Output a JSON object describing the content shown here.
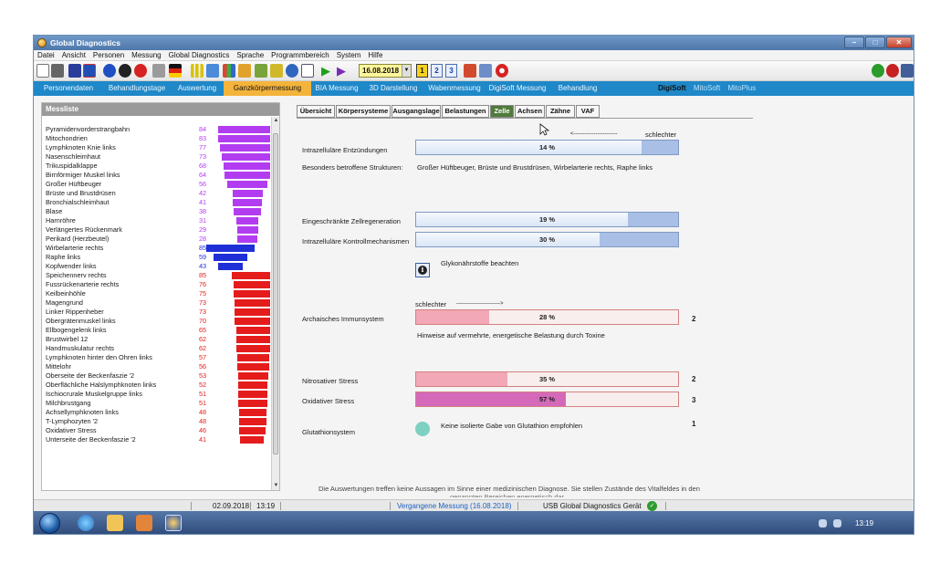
{
  "window": {
    "title": "Global Diagnostics",
    "min": "–",
    "max": "□",
    "close": "✕"
  },
  "menu": [
    "Datei",
    "Ansicht",
    "Personen",
    "Messung",
    "Global Diagnostics",
    "Sprache",
    "Programmbereich",
    "System",
    "Hilfe"
  ],
  "toolbar": {
    "date": "16.08.2018",
    "pages": [
      "1",
      "2",
      "3"
    ]
  },
  "nav": {
    "tabs": [
      "Personendaten",
      "Behandlungstage",
      "Auswertung",
      "Ganzkörpermessung",
      "BIA Messung",
      "3D Darstellung",
      "Wabenmessung",
      "DigiSoft Messung",
      "Behandlung"
    ],
    "right": [
      "DigiSoft",
      "MitoSoft",
      "MitoPlus"
    ]
  },
  "messliste": {
    "title": "Messliste",
    "rows": [
      {
        "name": "Pyramidenvorderstrangbahn",
        "value": 84,
        "color": "#b23df0"
      },
      {
        "name": "Mitochondrien",
        "value": 83,
        "color": "#b23df0"
      },
      {
        "name": "Lymphknoten Knie links",
        "value": 77,
        "color": "#b23df0"
      },
      {
        "name": "Nasenschleimhaut",
        "value": 73,
        "color": "#b23df0"
      },
      {
        "name": "Trikuspidalklappe",
        "value": 68,
        "color": "#b23df0"
      },
      {
        "name": "Birnförmiger Muskel links",
        "value": 64,
        "color": "#b23df0"
      },
      {
        "name": "Großer Hüftbeuger",
        "value": 56,
        "color": "#b23df0"
      },
      {
        "name": "Brüste und Brustdrüsen",
        "value": 42,
        "color": "#b23df0"
      },
      {
        "name": "Bronchialschleimhaut",
        "value": 41,
        "color": "#b23df0"
      },
      {
        "name": "Blase",
        "value": 38,
        "color": "#b23df0"
      },
      {
        "name": "Harnröhre",
        "value": 31,
        "color": "#b23df0"
      },
      {
        "name": "Verlängertes Rückenmark",
        "value": 29,
        "color": "#b23df0"
      },
      {
        "name": "Perikard (Herzbeutel)",
        "value": 28,
        "color": "#b23df0"
      },
      {
        "name": "Wirbelarterie rechts",
        "value": 85,
        "color": "#1f2fd8"
      },
      {
        "name": "Raphe links",
        "value": 59,
        "color": "#1f2fd8"
      },
      {
        "name": "Kopfwender links",
        "value": 43,
        "color": "#1f2fd8"
      },
      {
        "name": "Speichennerv rechts",
        "value": 85,
        "color": "#e51c1c"
      },
      {
        "name": "Fussrückenarterie rechts",
        "value": 76,
        "color": "#e51c1c"
      },
      {
        "name": "Keilbeinhöhle",
        "value": 75,
        "color": "#e51c1c"
      },
      {
        "name": "Magengrund",
        "value": 73,
        "color": "#e51c1c"
      },
      {
        "name": "Linker Rippenheber",
        "value": 73,
        "color": "#e51c1c"
      },
      {
        "name": "Obergrätenmuskel links",
        "value": 70,
        "color": "#e51c1c"
      },
      {
        "name": "Ellbogengelenk links",
        "value": 65,
        "color": "#e51c1c"
      },
      {
        "name": "Brustwirbel 12",
        "value": 62,
        "color": "#e51c1c"
      },
      {
        "name": "Handmuskulatur rechts",
        "value": 62,
        "color": "#e51c1c"
      },
      {
        "name": "Lymphknoten hinter den Ohren links",
        "value": 57,
        "color": "#e51c1c"
      },
      {
        "name": "Mittelohr",
        "value": 56,
        "color": "#e51c1c"
      },
      {
        "name": "Oberseite der Beckenfaszie '2",
        "value": 53,
        "color": "#e51c1c"
      },
      {
        "name": "Oberflächliche Halslymphknoten links",
        "value": 52,
        "color": "#e51c1c"
      },
      {
        "name": "Ischiocrurale Muskelgruppe links",
        "value": 51,
        "color": "#e51c1c"
      },
      {
        "name": "Milchbrustgang",
        "value": 51,
        "color": "#e51c1c"
      },
      {
        "name": "Achsellymphknoten links",
        "value": 48,
        "color": "#e51c1c"
      },
      {
        "name": "T-Lymphozyten '2",
        "value": 48,
        "color": "#e51c1c"
      },
      {
        "name": "Oxidativer Stress",
        "value": 46,
        "color": "#e51c1c"
      },
      {
        "name": "Unterseite der Beckenfaszie '2",
        "value": 41,
        "color": "#e51c1c"
      }
    ]
  },
  "tabs": [
    "Übersicht",
    "Körpersysteme",
    "Ausgangslage",
    "Belastungen",
    "Zelle",
    "Achsen",
    "Zähne",
    "VAF"
  ],
  "zelle": {
    "arrow_worse_right": "<------------------------",
    "worse": "schlechter",
    "entzuendungen": {
      "label": "Intrazelluläre Entzündungen",
      "pct": 14,
      "text": "14 %"
    },
    "strukturen_label": "Besonders betroffene Strukturen:",
    "strukturen_value": "Großer Hüftbeuger, Brüste und Brustdrüsen, Wirbelarterie rechts, Raphe links",
    "zellregeneration": {
      "label": "Eingeschränkte Zellregeneration",
      "pct": 19,
      "text": "19 %"
    },
    "kontroll": {
      "label": "Intrazelluläre Kontrollmechanismen",
      "pct": 30,
      "text": "30 %"
    },
    "glyko_note": "Glykonährstoffe beachten",
    "worse2": "schlechter",
    "arrow_worse_left": "------------------------>",
    "immun": {
      "label": "Archaisches Immunsystem",
      "pct": 28,
      "text": "28 %",
      "score": "2",
      "color": "#f2a8b6"
    },
    "immun_note": "Hinweise auf vermehrte, energetische Belastung durch Toxine",
    "nitro": {
      "label": "Nitrosativer Stress",
      "pct": 35,
      "text": "35 %",
      "score": "2",
      "color": "#f2a8b6"
    },
    "oxi": {
      "label": "Oxidativer Stress",
      "pct": 57,
      "text": "57 %",
      "score": "3",
      "color": "#d469b9"
    },
    "gluta": {
      "label": "Glutathionsystem",
      "note": "Keine isolierte Gabe von Glutathion empfohlen",
      "score": "1"
    },
    "disclaimer": "Die Auswertungen treffen keine Aussagen im Sinne einer medizinischen Diagnose. Sie stellen Zustände des Vitalfeldes in den",
    "disclaimer2": "genannten Bereichen energetisch dar."
  },
  "status": {
    "date": "02.09.2018",
    "time": "13:19",
    "measure": "Vergangene Messung (16.08.2018)",
    "device": "USB Global Diagnostics Gerät"
  },
  "taskbar": {
    "time": "13:19"
  },
  "icons": [
    "app-icon",
    "new-document-icon",
    "print-icon",
    "info-icon",
    "pointer-cursor-icon",
    "check-icon",
    "windows-start-icon"
  ]
}
